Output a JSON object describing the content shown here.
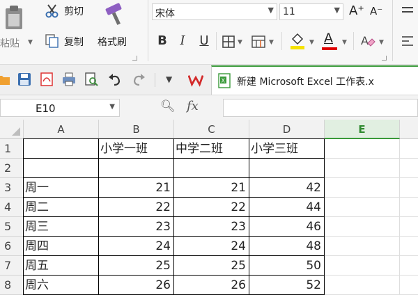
{
  "ribbon": {
    "paste_label": "粘贴",
    "cut_label": "剪切",
    "copy_label": "复制",
    "format_painter_label": "格式刷",
    "font_name": "宋体",
    "font_size": "11",
    "grow_font_label": "A⁺",
    "shrink_font_label": "A⁻",
    "bold_label": "B",
    "italic_label": "I",
    "underline_label": "U",
    "font_color_label": "A"
  },
  "doc_tab": {
    "title": "新建 Microsoft Excel 工作表.x"
  },
  "formula_bar": {
    "name_box": "E10",
    "fx_label": "fx",
    "formula": ""
  },
  "colors": {
    "accent": "#3a9a3a",
    "header_bg": "#f2f2f2"
  },
  "sheet": {
    "columns": [
      "A",
      "B",
      "C",
      "D",
      "E"
    ],
    "selected_column": "E",
    "rows": [
      {
        "num": "1",
        "A": "",
        "B": "小学一班",
        "C": "中学二班",
        "D": "小学三班"
      },
      {
        "num": "2",
        "A": "",
        "B": "",
        "C": "",
        "D": ""
      },
      {
        "num": "3",
        "A": "周一",
        "B": "21",
        "C": "21",
        "D": "42"
      },
      {
        "num": "4",
        "A": "周二",
        "B": "22",
        "C": "22",
        "D": "44"
      },
      {
        "num": "5",
        "A": "周三",
        "B": "23",
        "C": "23",
        "D": "46"
      },
      {
        "num": "6",
        "A": "周四",
        "B": "24",
        "C": "24",
        "D": "48"
      },
      {
        "num": "7",
        "A": "周五",
        "B": "25",
        "C": "25",
        "D": "50"
      },
      {
        "num": "8",
        "A": "周六",
        "B": "26",
        "C": "26",
        "D": "52"
      }
    ]
  }
}
